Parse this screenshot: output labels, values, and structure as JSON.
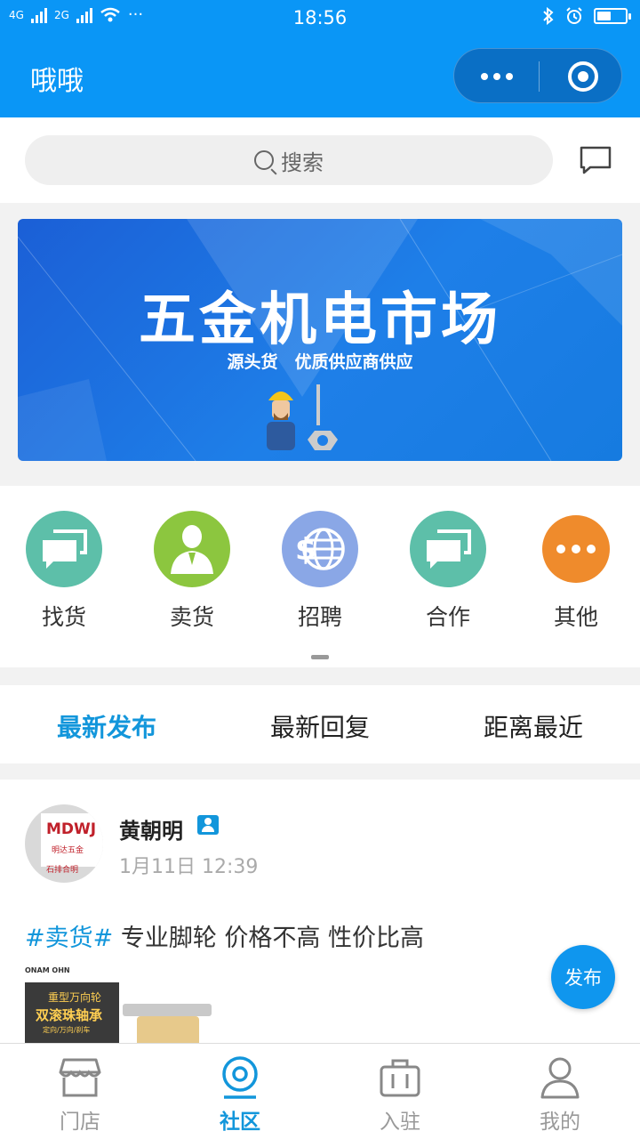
{
  "status_bar": {
    "network_1": "4G",
    "network_2": "2G",
    "dots": "···",
    "time": "18:56",
    "battery_level": 0.5,
    "bluetooth": "bluetooth-icon",
    "alarm": "alarm-icon"
  },
  "header": {
    "title": "哦哦",
    "menu_icon": "more-icon",
    "close_icon": "target-icon"
  },
  "search": {
    "placeholder": "搜索",
    "message_icon": "message-icon"
  },
  "banner": {
    "title": "五金机电市场",
    "subtitle": "源头货　优质供应商供应"
  },
  "categories": [
    {
      "label": "找货",
      "icon": "chat-bubbles-icon",
      "color": "#5dbfa9"
    },
    {
      "label": "卖货",
      "icon": "person-icon",
      "color": "#8cc63f"
    },
    {
      "label": "招聘",
      "icon": "globe-icon",
      "color": "#8aa7e6"
    },
    {
      "label": "合作",
      "icon": "chat-bubbles-icon",
      "color": "#5dbfa9"
    },
    {
      "label": "其他",
      "icon": "more-dots-icon",
      "color": "#ef8b2c"
    }
  ],
  "tabs": [
    "最新发布",
    "最新回复",
    "距离最近"
  ],
  "post": {
    "author": "黄朝明",
    "time": "1月11日 12:39",
    "tag": "#卖货#",
    "text": " 专业脚轮 价格不高 性价比高",
    "avatar_text": "MDWJ",
    "avatar_line2": "明达五金",
    "avatar_line3": "石排合明",
    "image": {
      "brand": "ONAM OHN",
      "line1": "重型万向轮",
      "line2": "双滚珠轴承",
      "line3": "定向/万向/刹车"
    }
  },
  "fab_label": "发布",
  "bottom_nav": [
    {
      "label": "门店",
      "icon": "store-icon",
      "active": false
    },
    {
      "label": "社区",
      "icon": "location-icon",
      "active": true
    },
    {
      "label": "入驻",
      "icon": "briefcase-icon",
      "active": false
    },
    {
      "label": "我的",
      "icon": "user-icon",
      "active": false
    }
  ],
  "colors": {
    "primary": "#0a96f6",
    "accent": "#1296db"
  }
}
